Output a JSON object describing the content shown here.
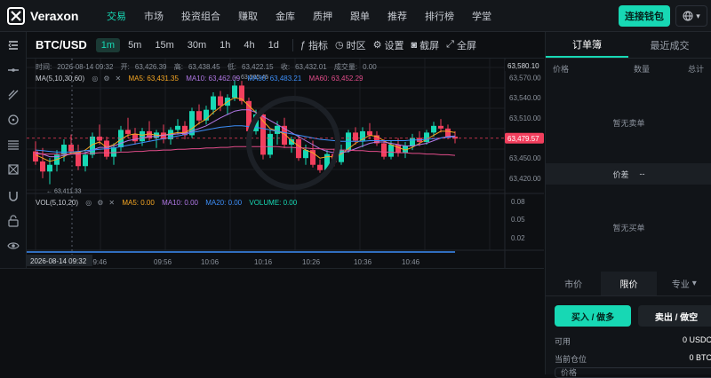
{
  "app": {
    "name": "Veraxon"
  },
  "nav": {
    "items": [
      "交易",
      "市场",
      "投资组合",
      "赚取",
      "金库",
      "质押",
      "跟单",
      "推荐",
      "排行榜",
      "学堂"
    ],
    "active_index": 0
  },
  "header": {
    "connect_label": "连接钱包",
    "lang_icon": "globe-icon"
  },
  "toolbar": {
    "pair": "BTC/USD",
    "timeframes": [
      "1m",
      "5m",
      "15m",
      "30m",
      "1h",
      "4h",
      "1d"
    ],
    "active_timeframe": "1m",
    "indicators_label": "指标",
    "timezone_label": "时区",
    "settings_label": "设置",
    "screenshot_label": "截屏",
    "fullscreen_label": "全屏"
  },
  "ohlc_bar": {
    "time_label": "时间:",
    "time": "2026-08-14 09:32",
    "open_label": "开:",
    "open": "63,426.39",
    "high_label": "高:",
    "high": "63,438.45",
    "low_label": "低:",
    "low": "63,422.15",
    "close_label": "收:",
    "close": "63,432.01",
    "volume_label": "成交量:",
    "volume": "0.00"
  },
  "ma_legend": {
    "title": "MA(5,10,30,60)",
    "ma5": "MA5: 63,431.35",
    "ma10": "MA10: 63,462.09",
    "ma30": "MA30: 63,483.21",
    "ma60": "MA60: 63,452.29"
  },
  "vol_legend": {
    "title": "VOL(5,10,20)",
    "ma5": "MA5: 0.00",
    "ma10": "MA10: 0.00",
    "ma20": "MA20: 0.00",
    "volume": "VOLUME: 0.00"
  },
  "price_axis": {
    "ticks": [
      "63,570.00",
      "63,540.00",
      "63,510.00",
      "63,480.00",
      "63,450.00",
      "63,420.00"
    ],
    "top_marker": "63,580.10",
    "current": "63,479.57"
  },
  "vol_axis": {
    "ticks": [
      "0.08",
      "0.05",
      "0.02"
    ]
  },
  "time_axis": {
    "ticks": [
      "09:46",
      "09:56",
      "10:06",
      "10:16",
      "10:26",
      "10:36",
      "10:46"
    ],
    "crosshair": "2026-08-14 09:32"
  },
  "annotations": {
    "high": "63,565.45",
    "low": "63,411.33"
  },
  "colors": {
    "up": "#17d8b4",
    "down": "#f23f5d",
    "ma5": "#f5a623",
    "ma10": "#b178e6",
    "ma30": "#3d8ef7",
    "ma60": "#e34d8b",
    "accent": "#17d8b4"
  },
  "chart_data": {
    "type": "candlestick",
    "y_range": [
      63400,
      63585
    ],
    "candles": [
      {
        "o": 63460,
        "h": 63475,
        "l": 63440,
        "c": 63445
      },
      {
        "o": 63445,
        "h": 63465,
        "l": 63420,
        "c": 63430
      },
      {
        "o": 63430,
        "h": 63450,
        "l": 63411,
        "c": 63440
      },
      {
        "o": 63440,
        "h": 63462,
        "l": 63430,
        "c": 63455
      },
      {
        "o": 63455,
        "h": 63478,
        "l": 63445,
        "c": 63470
      },
      {
        "o": 63470,
        "h": 63485,
        "l": 63455,
        "c": 63460
      },
      {
        "o": 63460,
        "h": 63470,
        "l": 63432,
        "c": 63438
      },
      {
        "o": 63438,
        "h": 63460,
        "l": 63430,
        "c": 63455
      },
      {
        "o": 63455,
        "h": 63488,
        "l": 63450,
        "c": 63482
      },
      {
        "o": 63482,
        "h": 63500,
        "l": 63470,
        "c": 63476
      },
      {
        "o": 63476,
        "h": 63482,
        "l": 63448,
        "c": 63452
      },
      {
        "o": 63452,
        "h": 63472,
        "l": 63440,
        "c": 63466
      },
      {
        "o": 63466,
        "h": 63498,
        "l": 63460,
        "c": 63492
      },
      {
        "o": 63492,
        "h": 63510,
        "l": 63480,
        "c": 63486
      },
      {
        "o": 63486,
        "h": 63495,
        "l": 63470,
        "c": 63475
      },
      {
        "o": 63475,
        "h": 63495,
        "l": 63468,
        "c": 63490
      },
      {
        "o": 63490,
        "h": 63505,
        "l": 63476,
        "c": 63480
      },
      {
        "o": 63480,
        "h": 63492,
        "l": 63465,
        "c": 63488
      },
      {
        "o": 63488,
        "h": 63500,
        "l": 63472,
        "c": 63478
      },
      {
        "o": 63478,
        "h": 63496,
        "l": 63470,
        "c": 63492
      },
      {
        "o": 63492,
        "h": 63508,
        "l": 63485,
        "c": 63498
      },
      {
        "o": 63498,
        "h": 63505,
        "l": 63478,
        "c": 63484
      },
      {
        "o": 63484,
        "h": 63525,
        "l": 63480,
        "c": 63520
      },
      {
        "o": 63520,
        "h": 63530,
        "l": 63500,
        "c": 63506
      },
      {
        "o": 63506,
        "h": 63528,
        "l": 63500,
        "c": 63522
      },
      {
        "o": 63522,
        "h": 63548,
        "l": 63515,
        "c": 63542
      },
      {
        "o": 63542,
        "h": 63550,
        "l": 63520,
        "c": 63528
      },
      {
        "o": 63528,
        "h": 63545,
        "l": 63515,
        "c": 63540
      },
      {
        "o": 63540,
        "h": 63566,
        "l": 63535,
        "c": 63558
      },
      {
        "o": 63558,
        "h": 63565,
        "l": 63530,
        "c": 63535
      },
      {
        "o": 63535,
        "h": 63540,
        "l": 63485,
        "c": 63490
      },
      {
        "o": 63490,
        "h": 63522,
        "l": 63485,
        "c": 63515
      },
      {
        "o": 63515,
        "h": 63525,
        "l": 63448,
        "c": 63455
      },
      {
        "o": 63455,
        "h": 63492,
        "l": 63450,
        "c": 63486
      },
      {
        "o": 63486,
        "h": 63505,
        "l": 63470,
        "c": 63498
      },
      {
        "o": 63498,
        "h": 63510,
        "l": 63465,
        "c": 63470
      },
      {
        "o": 63470,
        "h": 63482,
        "l": 63458,
        "c": 63478
      },
      {
        "o": 63478,
        "h": 63484,
        "l": 63446,
        "c": 63450
      },
      {
        "o": 63450,
        "h": 63470,
        "l": 63440,
        "c": 63462
      },
      {
        "o": 63462,
        "h": 63476,
        "l": 63436,
        "c": 63440
      },
      {
        "o": 63440,
        "h": 63448,
        "l": 63428,
        "c": 63432
      },
      {
        "o": 63432,
        "h": 63462,
        "l": 63430,
        "c": 63456
      },
      {
        "o": 63456,
        "h": 63464,
        "l": 63438,
        "c": 63444
      },
      {
        "o": 63444,
        "h": 63470,
        "l": 63440,
        "c": 63462
      },
      {
        "o": 63462,
        "h": 63492,
        "l": 63458,
        "c": 63488
      },
      {
        "o": 63488,
        "h": 63496,
        "l": 63470,
        "c": 63476
      },
      {
        "o": 63476,
        "h": 63496,
        "l": 63466,
        "c": 63490
      },
      {
        "o": 63490,
        "h": 63502,
        "l": 63478,
        "c": 63484
      },
      {
        "o": 63484,
        "h": 63490,
        "l": 63468,
        "c": 63472
      },
      {
        "o": 63472,
        "h": 63478,
        "l": 63448,
        "c": 63452
      },
      {
        "o": 63452,
        "h": 63476,
        "l": 63448,
        "c": 63470
      },
      {
        "o": 63470,
        "h": 63480,
        "l": 63452,
        "c": 63458
      },
      {
        "o": 63458,
        "h": 63474,
        "l": 63450,
        "c": 63468
      },
      {
        "o": 63468,
        "h": 63486,
        "l": 63462,
        "c": 63480
      },
      {
        "o": 63480,
        "h": 63490,
        "l": 63468,
        "c": 63474
      },
      {
        "o": 63474,
        "h": 63492,
        "l": 63470,
        "c": 63488
      },
      {
        "o": 63488,
        "h": 63504,
        "l": 63482,
        "c": 63498
      },
      {
        "o": 63498,
        "h": 63508,
        "l": 63488,
        "c": 63494
      },
      {
        "o": 63494,
        "h": 63500,
        "l": 63478,
        "c": 63482
      },
      {
        "o": 63482,
        "h": 63490,
        "l": 63472,
        "c": 63479
      }
    ],
    "ma5": [
      63455,
      63450,
      63445,
      63448,
      63452,
      63458,
      63458,
      63462,
      63470,
      63474,
      63466,
      63470,
      63478,
      63484,
      63486,
      63484,
      63486,
      63484,
      63484,
      63486,
      63488,
      63488,
      63494,
      63502,
      63508,
      63518,
      63526,
      63534,
      63540,
      63538,
      63528,
      63518,
      63505,
      63494,
      63490,
      63486,
      63476,
      63468,
      63462,
      63458,
      63450,
      63452,
      63452,
      63456,
      63464,
      63472,
      63478,
      63484,
      63482,
      63476,
      63470,
      63466,
      63462,
      63466,
      63472,
      63478,
      63484,
      63490,
      63490,
      63488
    ],
    "ma10": [
      63458,
      63456,
      63452,
      63452,
      63454,
      63456,
      63456,
      63458,
      63462,
      63466,
      63466,
      63468,
      63472,
      63476,
      63478,
      63480,
      63482,
      63482,
      63484,
      63485,
      63486,
      63487,
      63490,
      63494,
      63498,
      63504,
      63510,
      63515,
      63520,
      63522,
      63522,
      63518,
      63512,
      63506,
      63500,
      63494,
      63488,
      63482,
      63476,
      63470,
      63464,
      63460,
      63458,
      63458,
      63460,
      63464,
      63468,
      63472,
      63474,
      63474,
      63472,
      63470,
      63468,
      63468,
      63470,
      63472,
      63476,
      63480,
      63482,
      63483
    ],
    "ma30": [
      63462,
      63461,
      63460,
      63459,
      63459,
      63459,
      63460,
      63461,
      63462,
      63463,
      63464,
      63465,
      63467,
      63469,
      63471,
      63473,
      63475,
      63477,
      63479,
      63481,
      63483,
      63485,
      63488,
      63490,
      63492,
      63494,
      63496,
      63497,
      63498,
      63498,
      63497,
      63496,
      63494,
      63492,
      63490,
      63488,
      63486,
      63484,
      63482,
      63480,
      63478,
      63477,
      63476,
      63475,
      63475,
      63475,
      63475,
      63476,
      63476,
      63476,
      63476,
      63476,
      63476,
      63477,
      63477,
      63478,
      63479,
      63480,
      63481,
      63482
    ],
    "ma60": [
      63456,
      63456,
      63456,
      63456,
      63456,
      63456,
      63457,
      63457,
      63457,
      63458,
      63458,
      63458,
      63459,
      63459,
      63460,
      63460,
      63461,
      63461,
      63462,
      63462,
      63463,
      63463,
      63464,
      63464,
      63465,
      63465,
      63466,
      63466,
      63467,
      63467,
      63467,
      63467,
      63467,
      63467,
      63467,
      63466,
      63466,
      63465,
      63465,
      63464,
      63464,
      63463,
      63463,
      63462,
      63462,
      63461,
      63461,
      63460,
      63460,
      63459,
      63459,
      63458,
      63458,
      63457,
      63457,
      63456,
      63456,
      63455,
      63455,
      63454
    ]
  },
  "orderbook": {
    "tabs": [
      "订单簿",
      "最近成交"
    ],
    "active_tab": 0,
    "columns": [
      "价格",
      "数量",
      "总计"
    ],
    "no_asks": "暂无卖单",
    "no_bids": "暂无买单",
    "spread_label": "价差",
    "spread_value": "--"
  },
  "order_form": {
    "types": [
      "市价",
      "限价",
      "专业"
    ],
    "active_type": 1,
    "buy_label": "买入 / 做多",
    "sell_label": "卖出 / 做空",
    "available_label": "可用",
    "available_value": "0 USDC",
    "position_label": "当前仓位",
    "position_value": "0 BTC",
    "price_label": "价格"
  }
}
